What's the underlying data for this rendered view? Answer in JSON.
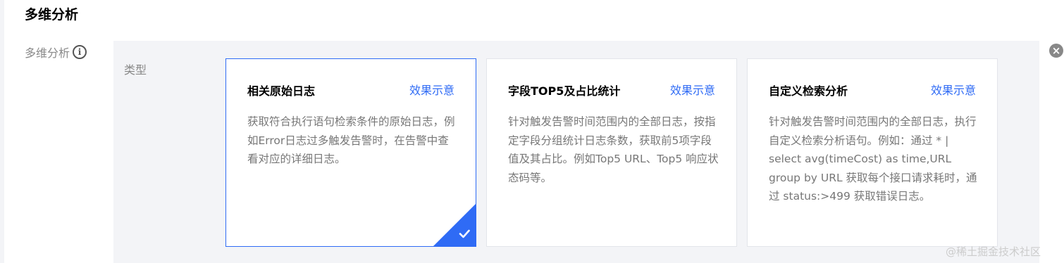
{
  "section": {
    "title": "多维分析"
  },
  "field": {
    "label": "多维分析",
    "info_icon": "info-icon"
  },
  "type_label": "类型",
  "cards": [
    {
      "title": "相关原始日志",
      "link": "效果示意",
      "description": "获取符合执行语句检索条件的原始日志，例如Error日志过多触发告警时，在告警中查看对应的详细日志。",
      "selected": true
    },
    {
      "title": "字段TOP5及占比统计",
      "link": "效果示意",
      "description": "针对触发告警时间范围内的全部日志，按指定字段分组统计日志条数，获取前5项字段值及其占比。例如Top5 URL、Top5 响应状态码等。",
      "selected": false
    },
    {
      "title": "自定义检索分析",
      "link": "效果示意",
      "description": "针对触发告警时间范围内的全部日志，执行自定义检索分析语句。例如：通过 * | select avg(timeCost) as time,URL group by URL 获取每个接口请求耗时，通过 status:>499 获取错误日志。",
      "selected": false
    }
  ],
  "colors": {
    "accent": "#2f6bf5",
    "panel_bg": "#f3f4f7",
    "muted_text": "#777777"
  },
  "watermark": "@稀土掘金技术社区"
}
